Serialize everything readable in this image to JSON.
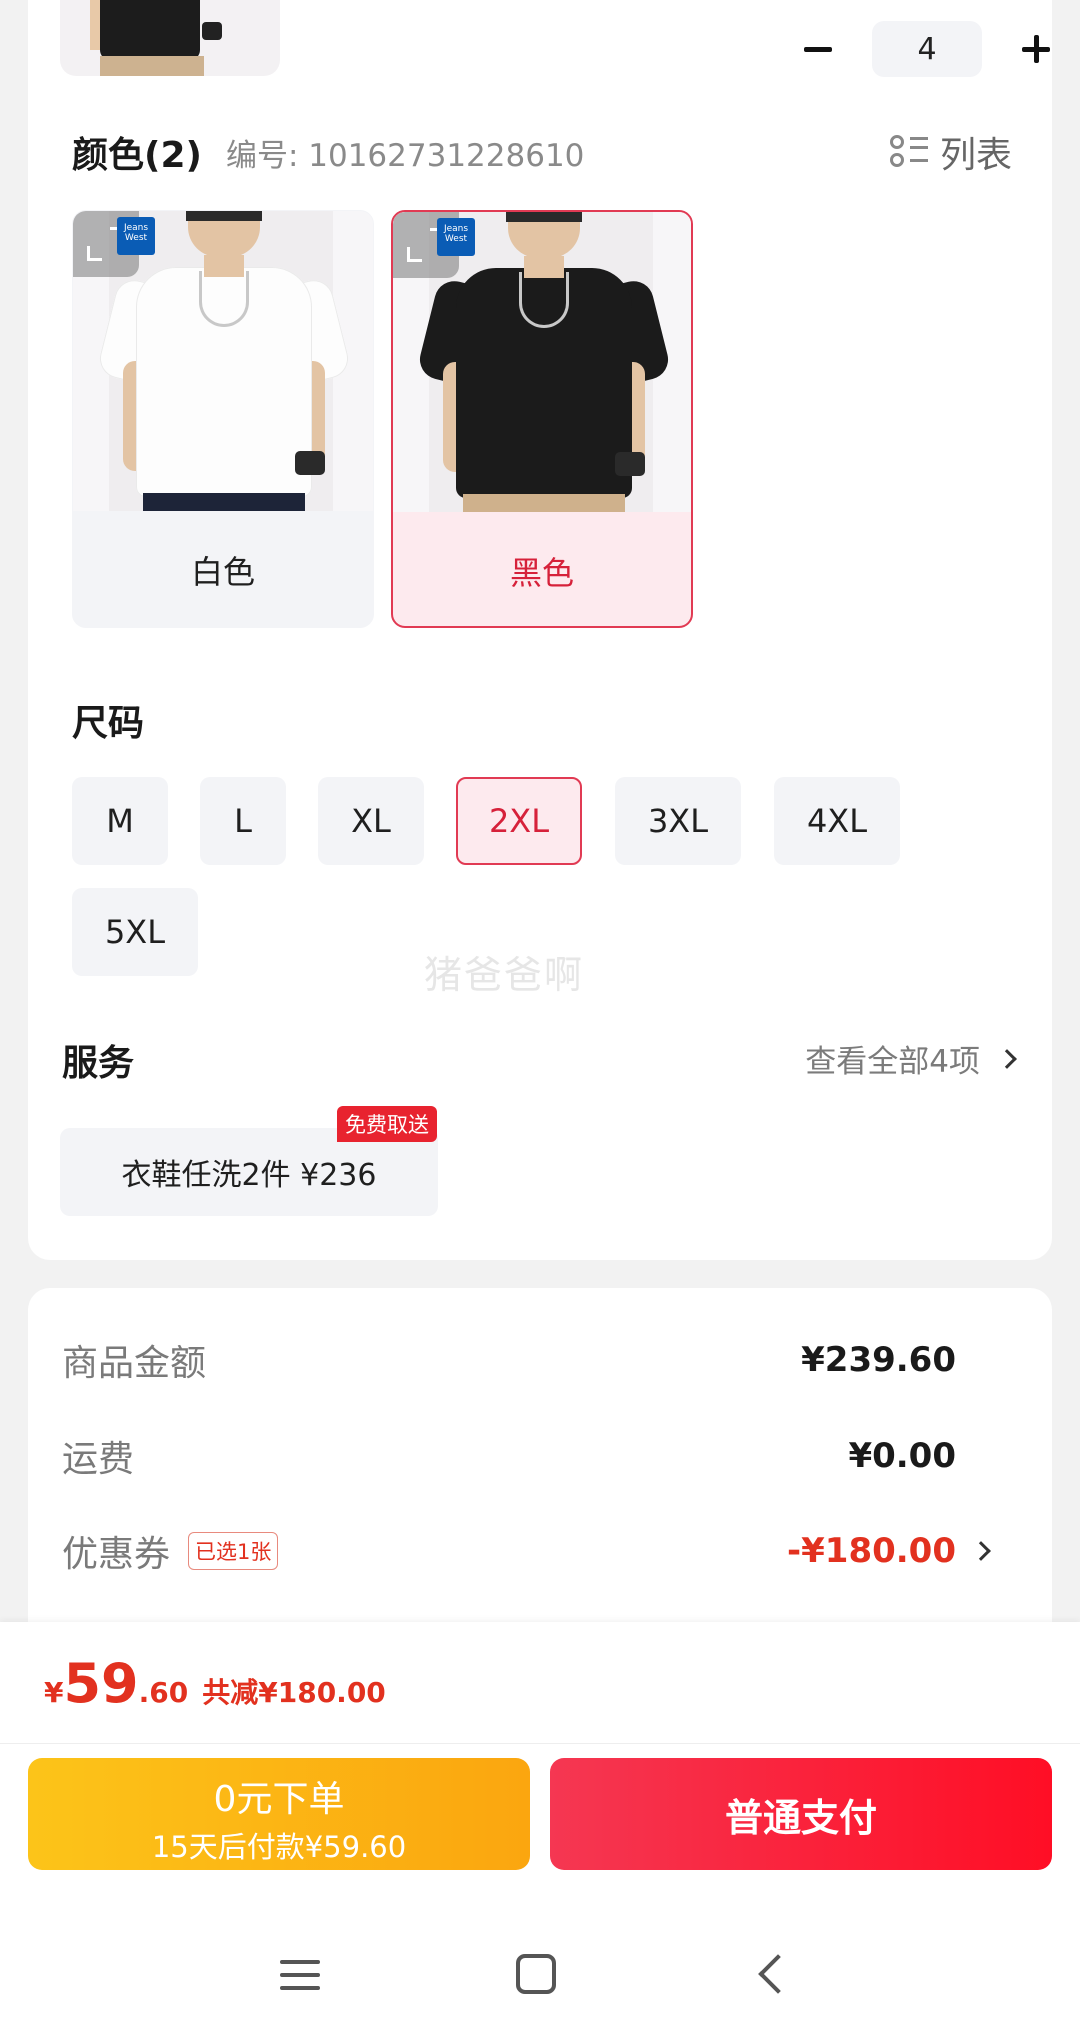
{
  "quantity": {
    "value": "4"
  },
  "color_section": {
    "title": "颜色(2)",
    "sku_label": "编号: 10162731228610",
    "list_toggle_label": "列表",
    "options": [
      {
        "label": "白色",
        "selected": false
      },
      {
        "label": "黑色",
        "selected": true
      }
    ],
    "brand_badge_text": "Jeans West"
  },
  "size_section": {
    "title": "尺码",
    "options": [
      {
        "label": "M",
        "selected": false
      },
      {
        "label": "L",
        "selected": false
      },
      {
        "label": "XL",
        "selected": false
      },
      {
        "label": "2XL",
        "selected": true
      },
      {
        "label": "3XL",
        "selected": false
      },
      {
        "label": "4XL",
        "selected": false
      },
      {
        "label": "5XL",
        "selected": false
      }
    ]
  },
  "watermark": "猪爸爸啊",
  "service_section": {
    "title": "服务",
    "view_all_label": "查看全部4项",
    "chip_label": "衣鞋任洗2件 ¥236",
    "chip_badge": "免费取送"
  },
  "price_summary": {
    "goods_amount_label": "商品金额",
    "goods_amount_value": "¥239.60",
    "shipping_label": "运费",
    "shipping_value": "¥0.00",
    "coupon_label": "优惠券",
    "coupon_tag": "已选1张",
    "coupon_value": "-¥180.00"
  },
  "bottom_bar": {
    "currency_symbol": "¥",
    "total_integer": "59",
    "total_decimal": ".60",
    "savings_text": "共减¥180.00",
    "zero_order_title": "0元下单",
    "zero_order_subtitle": "15天后付款¥59.60",
    "pay_button_label": "普通支付"
  },
  "colors": {
    "accent_red": "#e13a53",
    "price_red": "#e2311f",
    "pay_button_red": "#ff0e25",
    "zero_button_yellow": "#fcc419"
  }
}
